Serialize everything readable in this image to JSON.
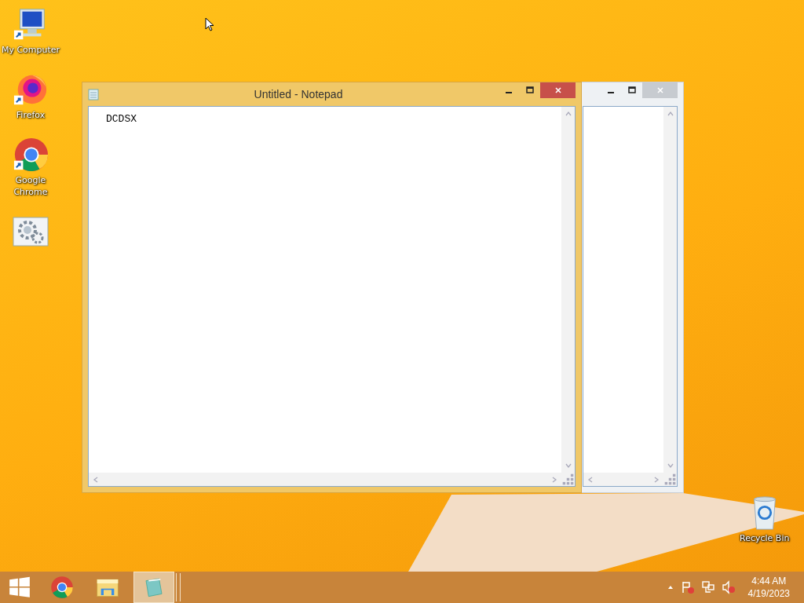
{
  "desktop_icons": [
    {
      "kind": "computer",
      "label": "My Computer"
    },
    {
      "kind": "firefox",
      "label": "Firefox"
    },
    {
      "kind": "chrome",
      "label": "Google Chrome"
    },
    {
      "kind": "settings"
    }
  ],
  "recycle_bin": {
    "label": "Recycle Bin"
  },
  "windows": [
    {
      "active": false
    },
    {
      "active": true,
      "title": "Untitled - Notepad",
      "text": "DCDSX"
    }
  ],
  "taskbar": {
    "items": [
      {
        "kind": "chrome",
        "selected": false
      },
      {
        "kind": "explorer",
        "selected": false
      },
      {
        "kind": "notepad",
        "selected": true
      }
    ],
    "clock": {
      "time": "4:44 AM",
      "date": "4/19/2023"
    }
  }
}
